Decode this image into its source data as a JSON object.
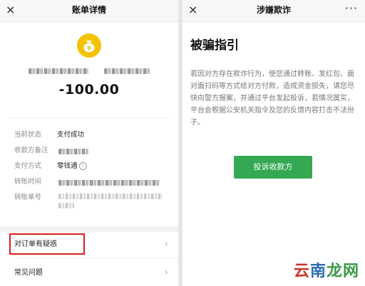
{
  "left": {
    "nav": {
      "title": "账单详情",
      "close_icon": "×"
    },
    "amount": "-100.00",
    "details": [
      {
        "label": "当前状态",
        "value": "支付成功"
      },
      {
        "label": "收款方备注",
        "value": ""
      },
      {
        "label": "支付方式",
        "value": "零钱通"
      },
      {
        "label": "转账时间",
        "value": ""
      },
      {
        "label": "转账单号",
        "value": ""
      }
    ],
    "list": [
      {
        "label": "对订单有疑惑",
        "chevron": "›"
      },
      {
        "label": "常见问题",
        "chevron": "›"
      }
    ],
    "colors": {
      "coin": "#f5c200",
      "highlight_box": "#d81e1e"
    }
  },
  "right": {
    "nav": {
      "title": "涉嫌欺诈",
      "close_icon": "×",
      "more_icon": "···"
    },
    "heading": "被骗指引",
    "body": "若因对方存在欺诈行为，使您通过转账、发红包、面对面扫码等方式给对方付款，造成资金损失，请您尽快向警方报案，并通过平台发起投诉，若情况属实，平台会根据公安机关指令及您的反馈内容打击不法份子。",
    "button": "投诉收款方",
    "colors": {
      "button": "#34a853"
    }
  },
  "watermark": {
    "part1": "云",
    "part2": "南",
    "part3": "龙网"
  }
}
